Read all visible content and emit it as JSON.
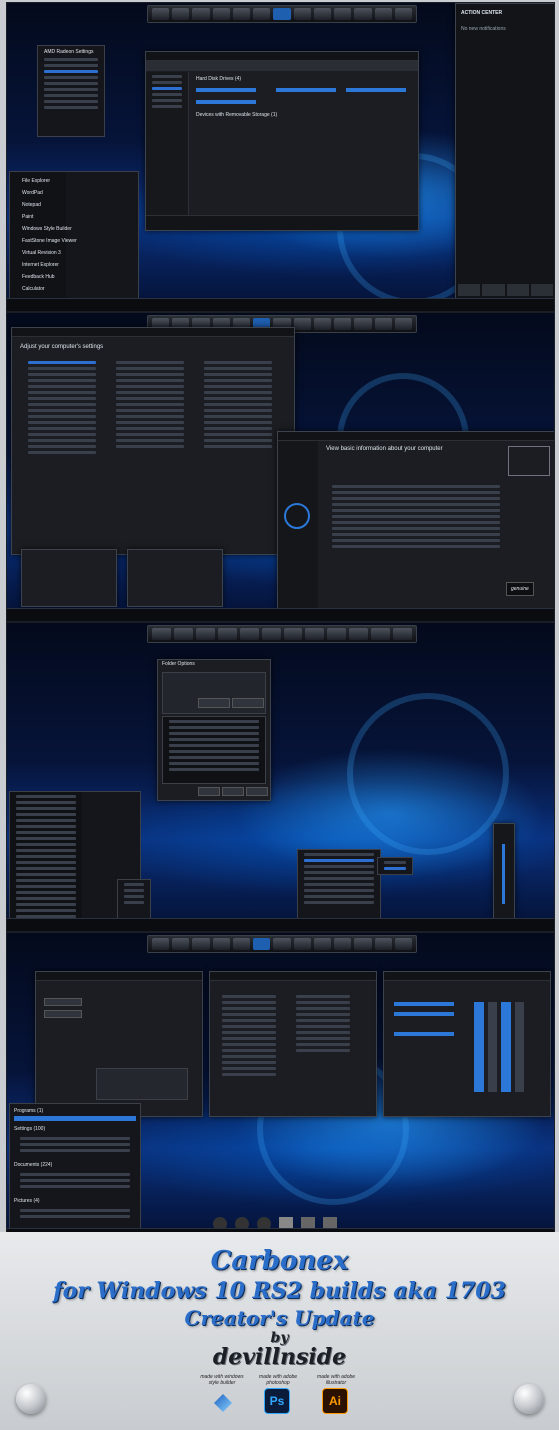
{
  "screens": {
    "one": {
      "action_center_title": "ACTION CENTER",
      "notifications": "No new notifications",
      "explorer_sections": [
        "Hard Disk Drives (4)",
        "Devices with Removable Storage (1)"
      ],
      "start_items": [
        "File Explorer",
        "WordPad",
        "Notepad",
        "Paint",
        "Windows Style Builder",
        "FastStone Image Viewer",
        "Virtual Revision 3",
        "Internet Explorer",
        "Feedback Hub",
        "Calculator"
      ],
      "context_items": [
        "AMD Radeon Settings",
        "Display",
        "Refresh",
        "Windows Style builder",
        "New",
        "Appearance",
        "Display settings",
        "Personalize (classic)",
        "Personalize"
      ]
    },
    "two": {
      "cp_heading": "Adjust your computer's settings",
      "sys_heading": "View basic information about your computer",
      "genuine": "genuine"
    },
    "three": {
      "dialog_title": "Folder Options",
      "buttons": [
        "Apply to Folders",
        "Reset Folders",
        "OK",
        "Cancel",
        "Apply"
      ]
    },
    "four": {
      "groups": [
        "Programs (1)",
        "Settings (100)",
        "Documents (224)",
        "Pictures (4)"
      ]
    }
  },
  "caption": {
    "line1": "Carbonex",
    "line2": "for Windows 10 RS2 builds aka 1703",
    "line3": "Creator's Update",
    "line4": "by",
    "line5": "devillnside"
  },
  "credits": {
    "label1": "made with windows style builder",
    "label2": "made with adobe photoshop",
    "label3": "made with adobe illustrator",
    "ps": "Ps",
    "ai": "Ai"
  },
  "colors": {
    "accent": "#2b78d8",
    "caption_blue": "#2a6ec9",
    "ps_bg": "#0b1c3a",
    "ps_fg": "#31a8ff",
    "ai_bg": "#2b1200",
    "ai_fg": "#ff9a00"
  }
}
